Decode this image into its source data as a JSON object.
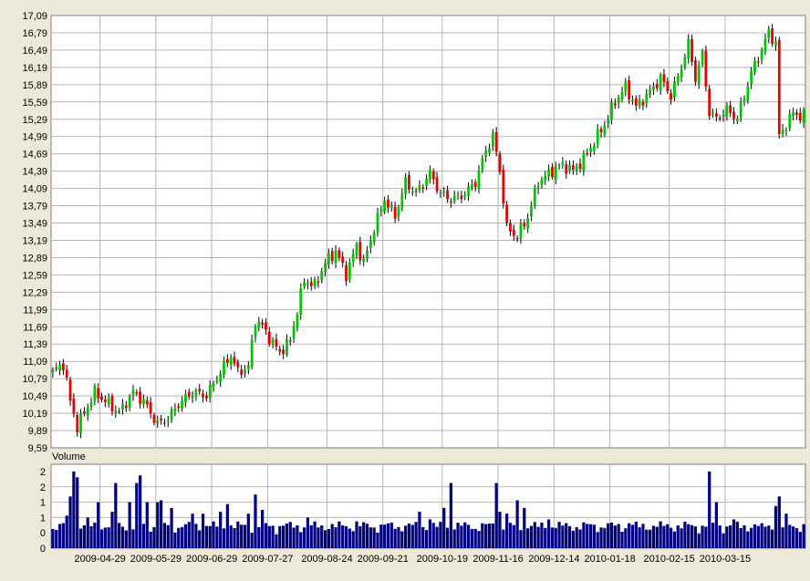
{
  "chart_data": [
    {
      "type": "candlestick",
      "ylim": [
        9.59,
        17.09
      ],
      "yticks": [
        "17,09",
        "16,79",
        "16,49",
        "16,19",
        "15,89",
        "15,59",
        "15,29",
        "14,99",
        "14,69",
        "14,39",
        "14,09",
        "13,79",
        "13,49",
        "13,19",
        "12,89",
        "12,59",
        "12,29",
        "11,99",
        "11,69",
        "11,39",
        "11,09",
        "10,79",
        "10,49",
        "10,19",
        "9,89",
        "9,59"
      ],
      "grid": true,
      "up_color": "#00c800",
      "down_color": "#e80000",
      "anchors": [
        {
          "i": 0,
          "v": 10.9
        },
        {
          "i": 3,
          "v": 11.05
        },
        {
          "i": 5,
          "v": 10.4
        },
        {
          "i": 7,
          "v": 9.95
        },
        {
          "i": 9,
          "v": 10.2
        },
        {
          "i": 12,
          "v": 10.55
        },
        {
          "i": 15,
          "v": 10.4
        },
        {
          "i": 19,
          "v": 10.2
        },
        {
          "i": 23,
          "v": 10.55
        },
        {
          "i": 26,
          "v": 10.4
        },
        {
          "i": 30,
          "v": 10.0
        },
        {
          "i": 33,
          "v": 10.1
        },
        {
          "i": 36,
          "v": 10.35
        },
        {
          "i": 40,
          "v": 10.55
        },
        {
          "i": 44,
          "v": 10.5
        },
        {
          "i": 48,
          "v": 10.9
        },
        {
          "i": 51,
          "v": 11.2
        },
        {
          "i": 53,
          "v": 10.9
        },
        {
          "i": 56,
          "v": 11.0
        },
        {
          "i": 58,
          "v": 11.8
        },
        {
          "i": 60,
          "v": 11.7
        },
        {
          "i": 63,
          "v": 11.4
        },
        {
          "i": 65,
          "v": 11.25
        },
        {
          "i": 68,
          "v": 11.45
        },
        {
          "i": 72,
          "v": 12.5
        },
        {
          "i": 75,
          "v": 12.4
        },
        {
          "i": 78,
          "v": 12.8
        },
        {
          "i": 81,
          "v": 13.0
        },
        {
          "i": 84,
          "v": 12.6
        },
        {
          "i": 87,
          "v": 13.1
        },
        {
          "i": 89,
          "v": 12.8
        },
        {
          "i": 92,
          "v": 13.4
        },
        {
          "i": 95,
          "v": 13.9
        },
        {
          "i": 98,
          "v": 13.6
        },
        {
          "i": 101,
          "v": 14.2
        },
        {
          "i": 104,
          "v": 14.0
        },
        {
          "i": 108,
          "v": 14.35
        },
        {
          "i": 111,
          "v": 14.0
        },
        {
          "i": 114,
          "v": 13.9
        },
        {
          "i": 118,
          "v": 14.0
        },
        {
          "i": 121,
          "v": 14.2
        },
        {
          "i": 124,
          "v": 14.75
        },
        {
          "i": 126,
          "v": 15.0
        },
        {
          "i": 128,
          "v": 14.4
        },
        {
          "i": 130,
          "v": 13.4
        },
        {
          "i": 133,
          "v": 13.25
        },
        {
          "i": 136,
          "v": 13.6
        },
        {
          "i": 139,
          "v": 14.2
        },
        {
          "i": 143,
          "v": 14.4
        },
        {
          "i": 146,
          "v": 14.5
        },
        {
          "i": 149,
          "v": 14.4
        },
        {
          "i": 152,
          "v": 14.6
        },
        {
          "i": 155,
          "v": 14.9
        },
        {
          "i": 158,
          "v": 15.2
        },
        {
          "i": 161,
          "v": 15.6
        },
        {
          "i": 164,
          "v": 15.85
        },
        {
          "i": 167,
          "v": 15.5
        },
        {
          "i": 170,
          "v": 15.7
        },
        {
          "i": 174,
          "v": 16.0
        },
        {
          "i": 177,
          "v": 15.7
        },
        {
          "i": 180,
          "v": 16.2
        },
        {
          "i": 182,
          "v": 16.6
        },
        {
          "i": 184,
          "v": 16.0
        },
        {
          "i": 186,
          "v": 16.4
        },
        {
          "i": 188,
          "v": 15.4
        },
        {
          "i": 190,
          "v": 15.3
        },
        {
          "i": 193,
          "v": 15.45
        },
        {
          "i": 196,
          "v": 15.3
        },
        {
          "i": 198,
          "v": 15.7
        },
        {
          "i": 200,
          "v": 16.1
        },
        {
          "i": 203,
          "v": 16.5
        },
        {
          "i": 205,
          "v": 16.8
        },
        {
          "i": 207,
          "v": 16.6
        },
        {
          "i": 208,
          "v": 15.0
        },
        {
          "i": 210,
          "v": 15.2
        },
        {
          "i": 212,
          "v": 15.4
        },
        {
          "i": 214,
          "v": 15.35
        }
      ],
      "volume": {
        "label": "Volume",
        "ylim": [
          0,
          2
        ],
        "yticks": [
          "2",
          "2",
          "1",
          "1",
          "0",
          "0"
        ],
        "color": "#000080",
        "spikes": [
          {
            "i": 4,
            "v": 0.85
          },
          {
            "i": 5,
            "v": 1.35
          },
          {
            "i": 6,
            "v": 2.0
          },
          {
            "i": 7,
            "v": 1.85
          },
          {
            "i": 10,
            "v": 0.8
          },
          {
            "i": 13,
            "v": 1.2
          },
          {
            "i": 17,
            "v": 0.95
          },
          {
            "i": 18,
            "v": 1.7
          },
          {
            "i": 22,
            "v": 1.2
          },
          {
            "i": 24,
            "v": 1.7
          },
          {
            "i": 25,
            "v": 1.9
          },
          {
            "i": 27,
            "v": 1.2
          },
          {
            "i": 30,
            "v": 1.2
          },
          {
            "i": 31,
            "v": 1.25
          },
          {
            "i": 34,
            "v": 1.05
          },
          {
            "i": 40,
            "v": 0.9
          },
          {
            "i": 43,
            "v": 0.9
          },
          {
            "i": 48,
            "v": 0.95
          },
          {
            "i": 50,
            "v": 1.15
          },
          {
            "i": 56,
            "v": 0.9
          },
          {
            "i": 58,
            "v": 1.4
          },
          {
            "i": 60,
            "v": 1.0
          },
          {
            "i": 73,
            "v": 0.8
          },
          {
            "i": 87,
            "v": 0.7
          },
          {
            "i": 105,
            "v": 0.95
          },
          {
            "i": 108,
            "v": 0.75
          },
          {
            "i": 112,
            "v": 1.05
          },
          {
            "i": 114,
            "v": 1.7
          },
          {
            "i": 127,
            "v": 1.7
          },
          {
            "i": 128,
            "v": 0.95
          },
          {
            "i": 130,
            "v": 0.9
          },
          {
            "i": 133,
            "v": 1.25
          },
          {
            "i": 135,
            "v": 1.05
          },
          {
            "i": 142,
            "v": 0.75
          },
          {
            "i": 165,
            "v": 0.65
          },
          {
            "i": 174,
            "v": 0.7
          },
          {
            "i": 188,
            "v": 2.0
          },
          {
            "i": 190,
            "v": 1.2
          },
          {
            "i": 195,
            "v": 0.75
          },
          {
            "i": 203,
            "v": 0.65
          },
          {
            "i": 207,
            "v": 1.1
          },
          {
            "i": 208,
            "v": 1.35
          },
          {
            "i": 210,
            "v": 0.9
          }
        ]
      },
      "x_labels": [
        "2009-04-29",
        "2009-05-29",
        "2009-06-29",
        "2009-07-27",
        "2009-08-24",
        "2009-09-21",
        "2009-10-19",
        "2009-11-16",
        "2009-12-14",
        "2010-01-18",
        "2010-02-15",
        "2010-03-15"
      ],
      "x_label_bars": [
        14,
        30,
        46,
        62,
        79,
        95,
        112,
        128,
        144,
        160,
        177,
        193
      ]
    }
  ]
}
